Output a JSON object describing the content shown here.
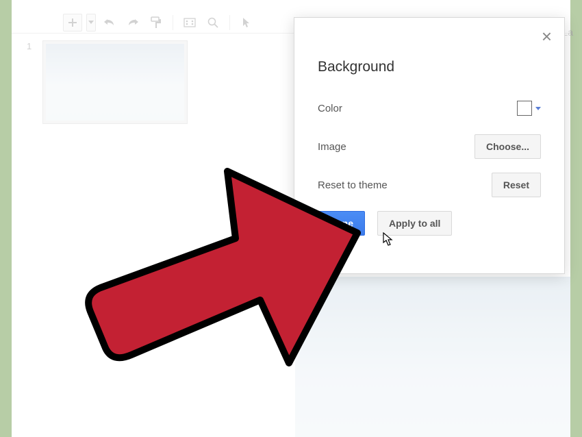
{
  "toolbar": {
    "layout_label": "La"
  },
  "slide_panel": {
    "slide_number": "1"
  },
  "dialog": {
    "title": "Background",
    "close_symbol": "×",
    "color_label": "Color",
    "image_label": "Image",
    "choose_button": "Choose...",
    "reset_label": "Reset to theme",
    "reset_button": "Reset",
    "done_button": "Done",
    "apply_all_button": "Apply to all"
  }
}
